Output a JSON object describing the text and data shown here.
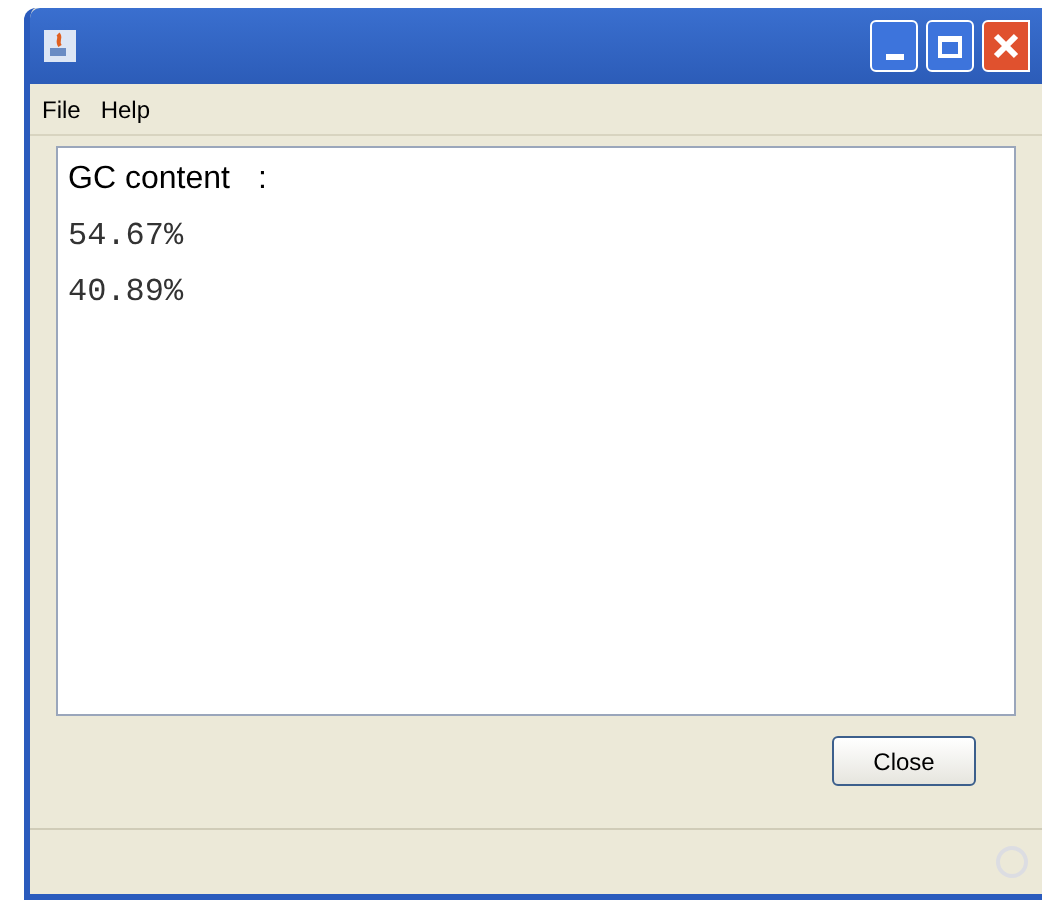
{
  "menu": [
    "File",
    "Help"
  ],
  "output": {
    "heading": "GC content",
    "separator": ":",
    "lines": [
      "54.67%",
      "40.89%"
    ]
  },
  "buttons": [
    "Close"
  ]
}
